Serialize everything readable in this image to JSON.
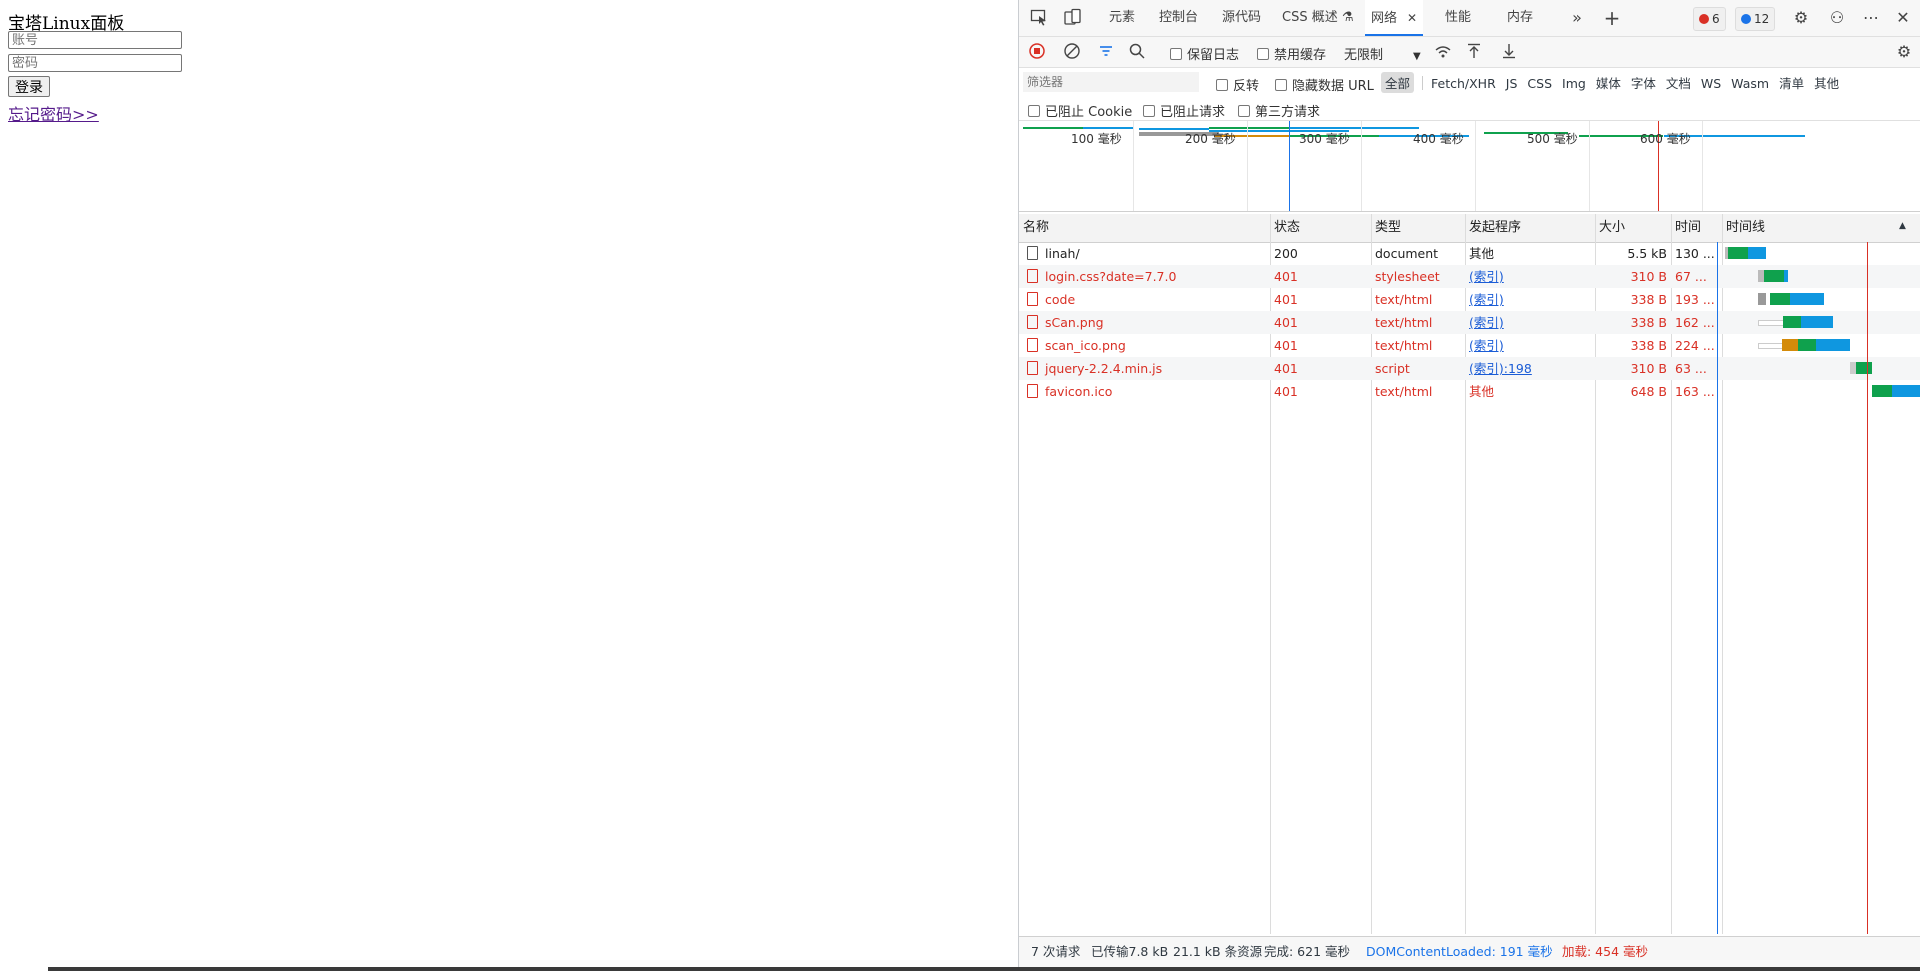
{
  "page": {
    "title": "宝塔Linux面板",
    "account_placeholder": "账号",
    "password_placeholder": "密码",
    "login_label": "登录",
    "forgot_link": "忘记密码>>"
  },
  "devtools": {
    "tabs": [
      "元素",
      "控制台",
      "源代码",
      "CSS 概述",
      "网络",
      "性能",
      "内存"
    ],
    "active_tab": "网络",
    "error_count": "6",
    "message_count": "12",
    "toolbar": {
      "preserve_log": "保留日志",
      "disable_cache": "禁用缓存",
      "throttling": "无限制"
    },
    "filter": {
      "placeholder": "筛选器",
      "invert": "反转",
      "hide_data_urls": "隐藏数据 URL",
      "types": [
        "全部",
        "Fetch/XHR",
        "JS",
        "CSS",
        "Img",
        "媒体",
        "字体",
        "文档",
        "WS",
        "Wasm",
        "清单",
        "其他"
      ],
      "blocked_cookies": "已阻止 Cookie",
      "blocked_requests": "已阻止请求",
      "third_party": "第三方请求"
    },
    "overview_ticks": [
      "100 毫秒",
      "200 毫秒",
      "300 毫秒",
      "400 毫秒",
      "500 毫秒",
      "600 毫秒"
    ],
    "columns": [
      "名称",
      "状态",
      "类型",
      "发起程序",
      "大小",
      "时间",
      "时间线"
    ],
    "rows": [
      {
        "name": "linah/",
        "status": "200",
        "type": "document",
        "initiator": "其他",
        "size": "5.5 kB",
        "time": "130 ...",
        "error": false,
        "initiator_link": false
      },
      {
        "name": "login.css?date=7.7.0",
        "status": "401",
        "type": "stylesheet",
        "initiator": "(索引)",
        "size": "310 B",
        "time": "67 ...",
        "error": true,
        "initiator_link": true
      },
      {
        "name": "code",
        "status": "401",
        "type": "text/html",
        "initiator": "(索引)",
        "size": "338 B",
        "time": "193 ...",
        "error": true,
        "initiator_link": true
      },
      {
        "name": "sCan.png",
        "status": "401",
        "type": "text/html",
        "initiator": "(索引)",
        "size": "338 B",
        "time": "162 ...",
        "error": true,
        "initiator_link": true
      },
      {
        "name": "scan_ico.png",
        "status": "401",
        "type": "text/html",
        "initiator": "(索引)",
        "size": "338 B",
        "time": "224 ...",
        "error": true,
        "initiator_link": true
      },
      {
        "name": "jquery-2.2.4.min.js",
        "status": "401",
        "type": "script",
        "initiator": "(索引):198",
        "size": "310 B",
        "time": "63 ...",
        "error": true,
        "initiator_link": true
      },
      {
        "name": "favicon.ico",
        "status": "401",
        "type": "text/html",
        "initiator": "其他",
        "size": "648 B",
        "time": "163 ...",
        "error": true,
        "initiator_link": false
      }
    ],
    "statusbar": {
      "requests": "7 次请求",
      "transferred": "已传输7.8 kB",
      "resources": "21.1 kB 条资源",
      "finish": "完成: 621 毫秒",
      "dcl": "DOMContentLoaded: 191 毫秒",
      "load": "加载: 454 毫秒"
    },
    "colors": {
      "error": "#d93025",
      "accent": "#1a73e8",
      "waiting": "#0fa14d",
      "download": "#0f97e0",
      "dns": "#d48b0a",
      "dcl_line": "#1a73e8",
      "load_line": "#d93025"
    }
  }
}
